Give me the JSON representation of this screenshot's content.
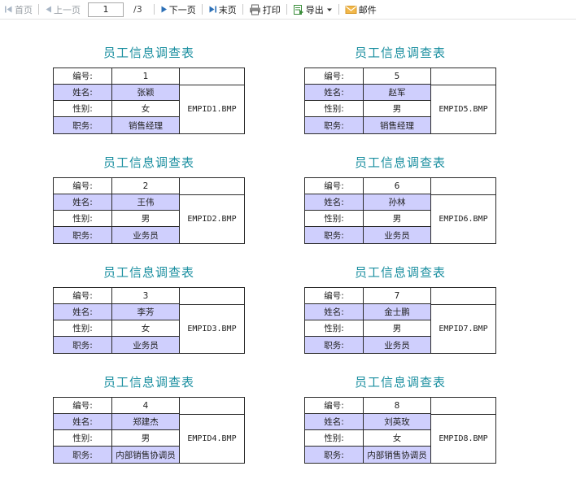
{
  "toolbar": {
    "first": "首页",
    "prev": "上一页",
    "page_value": "1",
    "page_total": "/3",
    "next": "下一页",
    "last": "末页",
    "print": "打印",
    "export": "导出",
    "mail": "邮件"
  },
  "cards": [
    {
      "title": "员工信息调查表",
      "labels": [
        "编号:",
        "姓名:",
        "性别:",
        "职务:"
      ],
      "values": [
        "1",
        "张颖",
        "女",
        "销售经理"
      ],
      "photo": "EMPID1.BMP"
    },
    {
      "title": "员工信息调查表",
      "labels": [
        "编号:",
        "姓名:",
        "性别:",
        "职务:"
      ],
      "values": [
        "5",
        "赵军",
        "男",
        "销售经理"
      ],
      "photo": "EMPID5.BMP"
    },
    {
      "title": "员工信息调查表",
      "labels": [
        "编号:",
        "姓名:",
        "性别:",
        "职务:"
      ],
      "values": [
        "2",
        "王伟",
        "男",
        "业务员"
      ],
      "photo": "EMPID2.BMP"
    },
    {
      "title": "员工信息调查表",
      "labels": [
        "编号:",
        "姓名:",
        "性别:",
        "职务:"
      ],
      "values": [
        "6",
        "孙林",
        "男",
        "业务员"
      ],
      "photo": "EMPID6.BMP"
    },
    {
      "title": "员工信息调查表",
      "labels": [
        "编号:",
        "姓名:",
        "性别:",
        "职务:"
      ],
      "values": [
        "3",
        "李芳",
        "女",
        "业务员"
      ],
      "photo": "EMPID3.BMP"
    },
    {
      "title": "员工信息调查表",
      "labels": [
        "编号:",
        "姓名:",
        "性别:",
        "职务:"
      ],
      "values": [
        "7",
        "金士鹏",
        "男",
        "业务员"
      ],
      "photo": "EMPID7.BMP"
    },
    {
      "title": "员工信息调查表",
      "labels": [
        "编号:",
        "姓名:",
        "性别:",
        "职务:"
      ],
      "values": [
        "4",
        "郑建杰",
        "男",
        "内部销售协调员"
      ],
      "photo": "EMPID4.BMP"
    },
    {
      "title": "员工信息调查表",
      "labels": [
        "编号:",
        "姓名:",
        "性别:",
        "职务:"
      ],
      "values": [
        "8",
        "刘英玫",
        "女",
        "内部销售协调员"
      ],
      "photo": "EMPID8.BMP"
    }
  ]
}
